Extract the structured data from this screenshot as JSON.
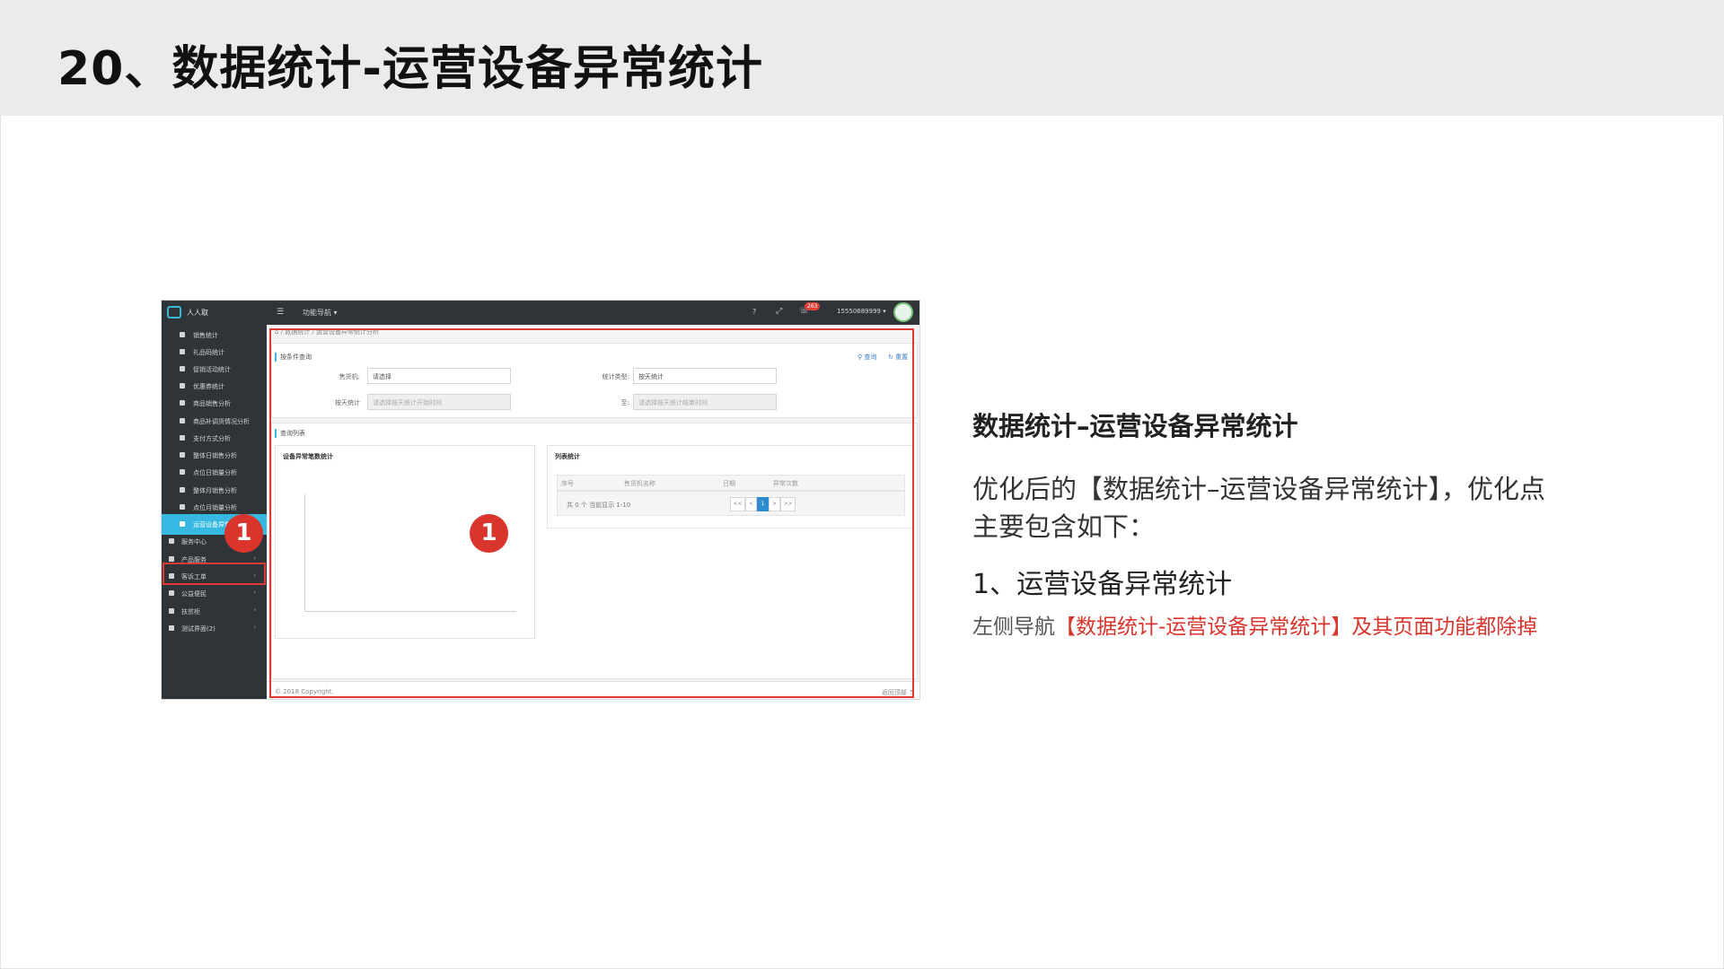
{
  "slide": {
    "title": "20、数据统计-运营设备异常统计"
  },
  "screenshot": {
    "topbar": {
      "brand": "人人取",
      "menu_toggle": "☰",
      "nav_menu": "功能导航 ▾",
      "help": "?",
      "expand": "⤢",
      "bell": "☏",
      "badge": "263",
      "user": "15550689999 ▾"
    },
    "sidebar": {
      "items": [
        {
          "label": "销售统计"
        },
        {
          "label": "礼品码统计"
        },
        {
          "label": "促销活动统计"
        },
        {
          "label": "优惠券统计"
        },
        {
          "label": "商品销售分析"
        },
        {
          "label": "商品补调货情况分析"
        },
        {
          "label": "支付方式分析"
        },
        {
          "label": "整体日销售分析"
        },
        {
          "label": "点位日销量分析"
        },
        {
          "label": "整体月销售分析"
        },
        {
          "label": "点位月销量分析"
        },
        {
          "label": "运营设备异常统计..."
        }
      ],
      "groups": [
        {
          "label": "服务中心",
          "arrow": "›"
        },
        {
          "label": "产品服务",
          "arrow": "›"
        },
        {
          "label": "客诉工单",
          "arrow": "›"
        },
        {
          "label": "公益便民",
          "arrow": "›"
        },
        {
          "label": "扶贫柜",
          "arrow": "›"
        },
        {
          "label": "测试界面(2)",
          "arrow": "›"
        }
      ]
    },
    "breadcrumb": "⌂ / 数据统计 / 运营设备异常统计分析",
    "query": {
      "section_label": "按条件查询",
      "search_button": "⚲ 查询",
      "reset_button": "↻ 重置",
      "vending_label": "售货机:",
      "vending_value": "请选择",
      "stat_type_label": "统计类型:",
      "stat_type_value": "按天统计",
      "by_day_label": "按天统计",
      "start_placeholder": "请选择按天统计开始时间",
      "to_label": "至:",
      "end_placeholder": "请选择按天统计结束时间"
    },
    "list": {
      "section_label": "查询列表",
      "chart_card_title": "设备异常笔数统计",
      "table_card_title": "列表统计",
      "columns": [
        "序号",
        "售货机名称",
        "日期",
        "异常次数"
      ],
      "pager_summary": "共 0 个 当前显示 1-10",
      "pager_buttons": [
        "<<",
        "<",
        "1",
        ">",
        ">>"
      ]
    },
    "footer": {
      "copyright": "© 2018 Copyright.",
      "back_top": "返回顶部 ⇡"
    },
    "markers": [
      "1",
      "1"
    ]
  },
  "info": {
    "heading": "数据统计–运营设备异常统计",
    "intro": "优化后的【数据统计–运营设备异常统计】，优化点主要包含如下：",
    "item": "1、运营设备异常统计",
    "desc_prefix": "左侧导航",
    "desc_highlight": "【数据统计-运营设备异常统计】及其页面功能都除掉"
  },
  "colors": {
    "accent_red": "#d9352c",
    "sidebar_active": "#36b8e0",
    "sidebar_bg": "#2f3439"
  }
}
